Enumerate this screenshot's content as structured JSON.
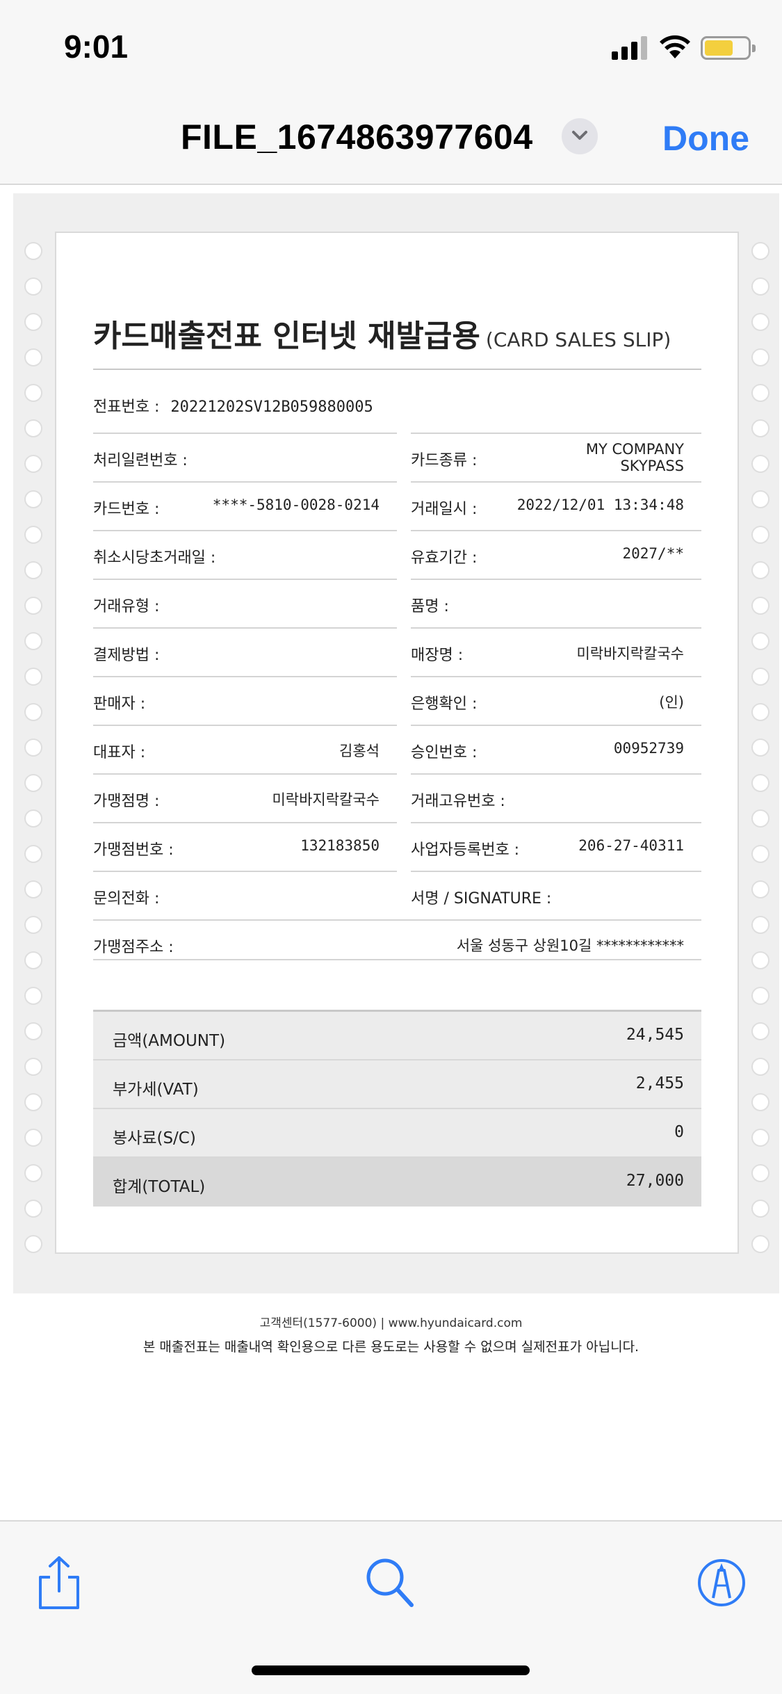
{
  "status_bar": {
    "time": "9:01",
    "battery_color": "#f3cf3e"
  },
  "nav": {
    "filename": "FILE_1674863977604",
    "done_label": "Done",
    "accent": "#2f7cf6"
  },
  "slip": {
    "title_ko": "카드매출전표 인터넷 재발급용",
    "title_en": "(CARD SALES SLIP)",
    "slip_no_label": "전표번호 :",
    "slip_no_value": "20221202SV12B059880005",
    "fields": {
      "serial_label": "처리일련번호 :",
      "serial_value": "",
      "card_type_label": "카드종류 :",
      "card_type_value": "MY COMPANY SKYPASS",
      "card_no_label": "카드번호 :",
      "card_no_value": "****-5810-0028-0214",
      "tx_datetime_label": "거래일시 :",
      "tx_datetime_value": "2022/12/01 13:34:48",
      "cancel_orig_label": "취소시당초거래일 :",
      "cancel_orig_value": "",
      "expiry_label": "유효기간 :",
      "expiry_value": "2027/**",
      "tx_type_label": "거래유형 :",
      "tx_type_value": "",
      "item_label": "품명 :",
      "item_value": "",
      "pay_method_label": "결제방법 :",
      "pay_method_value": "",
      "store_name_label": "매장명 :",
      "store_name_value": "미락바지락칼국수",
      "seller_label": "판매자 :",
      "seller_value": "",
      "bank_confirm_label": "은행확인 :",
      "bank_confirm_value": "(인)",
      "ceo_label": "대표자 :",
      "ceo_value": "김홍석",
      "approval_label": "승인번호 :",
      "approval_value": "00952739",
      "merchant_name_label": "가맹점명 :",
      "merchant_name_value": "미락바지락칼국수",
      "tx_unique_label": "거래고유번호 :",
      "tx_unique_value": "",
      "merchant_no_label": "가맹점번호 :",
      "merchant_no_value": "132183850",
      "biz_reg_label": "사업자등록번호 :",
      "biz_reg_value": "206-27-40311",
      "phone_label": "문의전화 :",
      "phone_value": "",
      "signature_label": "서명 / SIGNATURE :",
      "signature_value": "",
      "address_label": "가맹점주소 :",
      "address_value": "서울 성동구 상원10길 ************"
    },
    "totals": [
      {
        "label": "금액(AMOUNT)",
        "value": "24,545"
      },
      {
        "label": "부가세(VAT)",
        "value": "2,455"
      },
      {
        "label": "봉사료(S/C)",
        "value": "0"
      },
      {
        "label": "합계(TOTAL)",
        "value": "27,000"
      }
    ]
  },
  "footer": {
    "contact": "고객센터(1577-6000)  |  www.hyundaicard.com",
    "notice": "본 매출전표는 매출내역 확인용으로 다른 용도로는 사용할 수 없으며 실제전표가 아닙니다."
  },
  "toolbar": {
    "share_icon": "share-icon",
    "search_icon": "search-icon",
    "markup_icon": "markup-pen-icon"
  }
}
